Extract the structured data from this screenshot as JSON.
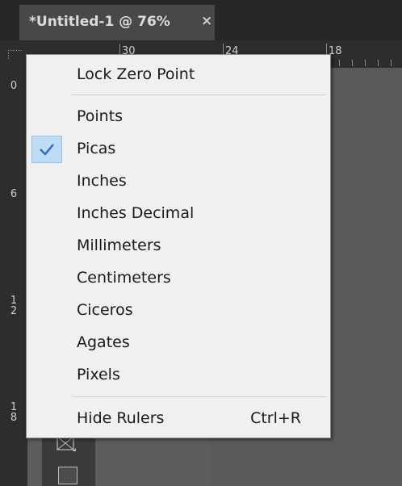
{
  "tab": {
    "title": "*Untitled-1 @ 76%",
    "close": "×"
  },
  "ruler": {
    "h_labels": [
      "30",
      "24",
      "18"
    ],
    "v_labels": [
      "0",
      "6",
      "1\n2",
      "1\n8"
    ]
  },
  "menu": {
    "lock_zero_point": "Lock Zero Point",
    "units": [
      {
        "label": "Points",
        "checked": false
      },
      {
        "label": "Picas",
        "checked": true
      },
      {
        "label": "Inches",
        "checked": false
      },
      {
        "label": "Inches Decimal",
        "checked": false
      },
      {
        "label": "Millimeters",
        "checked": false
      },
      {
        "label": "Centimeters",
        "checked": false
      },
      {
        "label": "Ciceros",
        "checked": false
      },
      {
        "label": "Agates",
        "checked": false
      },
      {
        "label": "Pixels",
        "checked": false
      }
    ],
    "hide_rulers": {
      "label": "Hide Rulers",
      "shortcut": "Ctrl+R"
    }
  },
  "colors": {
    "menu_bg": "#f0f0f0",
    "check_highlight": "#bfdcf4",
    "checkmark": "#2b6cc4"
  }
}
